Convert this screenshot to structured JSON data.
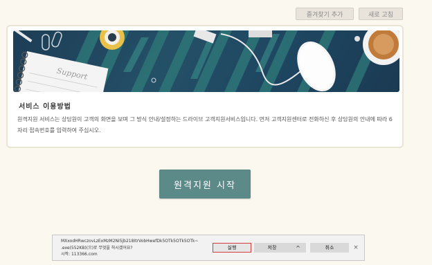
{
  "toolbar": {
    "add_favorite": "즐겨찾기 추가",
    "refresh": "새로 고침"
  },
  "card": {
    "banner_label": "Support",
    "title": "서비스 이용방법",
    "description": "원격지원 서비스는 상담원이 고객의 화면을 보며 그 방식 안내/설정하는 드라이브 고객지원서비스입니다. 먼저 고객지원센터로 전화하신 후 상담원의 안내에 따라 6자리 접속번호를 입력하여 주십시오."
  },
  "start_button": "원격지원 시작",
  "download_bar": {
    "filename_line1": "MXxodHRwczovLzExMzM2Ni5jb218ItrVobHwefDk5OTk5OTk5OTk~",
    "filename_line2": ".exe(552KB)(으)로 무엇을 하시겠어요?",
    "source": "시작: 113366.com",
    "run": "실행",
    "save": "저장",
    "more": "^",
    "cancel": "취소",
    "close": "×"
  }
}
